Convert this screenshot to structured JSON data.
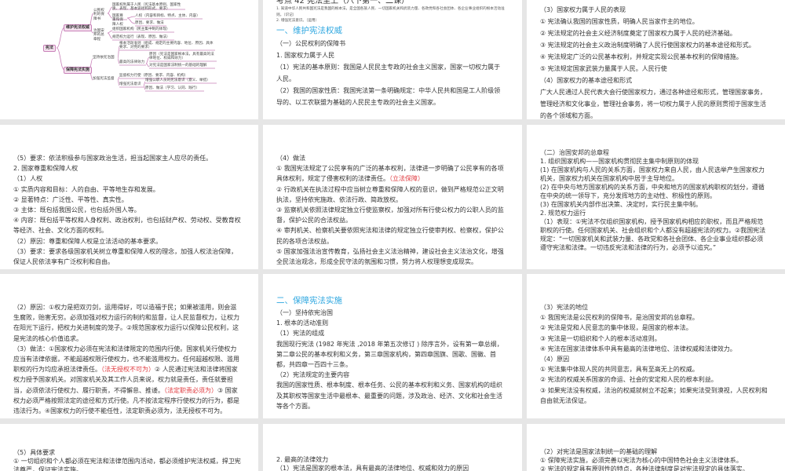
{
  "mindmap": {
    "root": "宪法",
    "b1": "维护宪法权威",
    "b2": "保障宪法实施",
    "b1_1": "公民权利的保障书",
    "b1_2": "治国安邦的总章程",
    "b2_1": "坚持依宪治国",
    "b2_2": "加强宪法监督",
    "n1": "国家权利属于人民（宪法基本原则、国家性质、表现、基本途径和形式、要求）",
    "n2": "国家尊重和保障人权",
    "n3": "人权（内容和目标、特点、主体、内容）",
    "n4": "原因、要求、做法",
    "n5": "组织国家机构（民主集中制的体现）",
    "n6": "规范权力运行（表现、原因、做法）",
    "n7": "根本活动准则（组成、规定的主要内容、地位、原因、具体要求、对党的要求）",
    "n8": "最高的法律效力",
    "n9": "原因（宪法是国家根本法，具有最高的法律地位、权威和效力）",
    "n10": "对宪法是国家法制统一的基础的理解",
    "n11": "监督权力行使（原因、要求、内容、机构）",
    "n12": "增强宪法意识",
    "n13": "增强公职人员的宪法意识（意义、举措）",
    "n14": "原因、做法（学习、认同、践行）"
  },
  "colors": {
    "heading": "#2ea7e0",
    "emphasis": "#e0393e",
    "mindmap_line": "#c880b8"
  },
  "slides": [
    {
      "id": "s2",
      "paras": [
        {
          "cls": "title",
          "t": "考点 42 宪法至上（八下第一、二课）"
        },
        {
          "cls": "small",
          "t": "1. 知道中华人民共和国宪法是我国的根本法，是全国各族人民、一切国家机关和武装力量、各政党和各社会团体、各企业事业组织的根本活动准则。（识记）"
        },
        {
          "cls": "small",
          "t": "2. 增强宪法意识。（运用）"
        },
        {
          "cls": "h-blue",
          "t": "一、维护宪法权威"
        },
        {
          "t": "（一）公民权利的保障书"
        },
        {
          "t": "1. 国家权力属于人民"
        },
        {
          "t": "（1）宪法的基本原则：我国是人民民主专政的社会主义国家，国家一切权力属于人民。"
        },
        {
          "t": "（2）我国的国家性质：我国宪法第一条明确规定：中华人民共和国是工人阶级领导的、以工农联盟为基础的人民民主专政的社会主义国家。"
        }
      ]
    },
    {
      "id": "s3",
      "paras": [
        {
          "t": "（3）国家权力属于人民的表现"
        },
        {
          "t": "① 宪法确认我国的国家性质，明确人民当家作主的地位。"
        },
        {
          "t": "② 宪法规定的社会主义经济制度奠定了国家权力属于人民的经济基础。"
        },
        {
          "t": "③ 宪法规定的社会主义政治制度明确了人民行使国家权力的基本途径和形式。"
        },
        {
          "t": "④ 宪法规定广泛的公民基本权利，并规定实现公民基本权利的保障措施。"
        },
        {
          "t": "⑤ 宪法规定国家武装力量属于人民。人民行使"
        },
        {
          "t": "（4）国家权力的基本途径和形式"
        },
        {
          "t": "广大人民通过人民代表大会行使国家权力，通过各种途径和形式，管理国家事务，管理经济和文化事业，管理社会事务，将一切权力属于人民的原则贯彻于国家生活的各个领域和方面。"
        }
      ]
    },
    {
      "id": "s4",
      "paras": [
        {
          "t": "（5）要求：依法积极参与国家政治生活，担当起国家主人应尽的责任。"
        },
        {
          "t": "2. 国家尊重和保障人权"
        },
        {
          "t": "（1）人权"
        },
        {
          "t": "① 实质内容和目标：人的自由、平等地生存和发展。"
        },
        {
          "t": "② 显著特点：广泛性、平等性、真实性。"
        },
        {
          "t": "③ 主体：既包括我国公民，也包括外国人等。"
        },
        {
          "t": "④ 内容：既包括平等权和人身权利、政治权利，也包括财产权、劳动权、受教育权等经济、社会、文化方面的权利。"
        },
        {
          "t": "（2）原因：尊重和保障人权是立法活动的基本要求。"
        },
        {
          "t": "（3）要求：要求各级国家机关树立尊重和保障人权的理念，加强人权法治保障，保证人民依法享有广泛权利和自由。"
        }
      ]
    },
    {
      "id": "s5",
      "paras": [
        {
          "t": "（4）做法"
        },
        {
          "t": "① 我国宪法规定了公民享有的广泛的基本权利，法律进一步明确了公民享有的各项具体权利，规定了侵害权利的法律责任。",
          "red": "（立法保障）"
        },
        {
          "t": "② 行政机关在执法过程中应当树立尊重和保障人权的意识，做到严格规范公正文明执法，坚持依宪施政、依法行政、简政放权。"
        },
        {
          "t": "③ 监察机关依照法律规定独立行使监察权，加强对所有行使公权力的公职人员的监督，保护公民的合法权益。"
        },
        {
          "t": "④ 审判机关、检察机关要依照宪法和法律的规定独立行使审判权、检察权，保护公民的各项合法权益。"
        },
        {
          "t": "⑤ 国家加强法治宣传教育，弘扬社会主义法治精神，建设社会主义法治文化，增强全民法治观念，形成全民守法的氛围和习惯，努力将人权理想变成现实。"
        }
      ]
    },
    {
      "id": "s6",
      "paras": [
        {
          "t": "（二）治国安邦的总章程"
        },
        {
          "t": "1. 组织国家机构——国家机构贯彻民主集中制原则的体现"
        },
        {
          "t": "(1) 在国家机构与人民的关系方面，国家权力来自人民，由人民选举产生国家权力机关，国家权力机关在国家机构中居于主导地位。"
        },
        {
          "t": "(2) 在中央与地方国家机构的关系方面，中央和地方的国家机构职权的划分，遵循在中央的统一领导下，充分发挥地方的主动性、积极性的原则。"
        },
        {
          "t": "(3) 在国家机关内部作出决策、决定时，实行民主集中制。"
        },
        {
          "t": "2. 规范权力运行"
        },
        {
          "t": "（1）表现：①宪法不仅组织国家机构，授予国家机构相应的职权，而且严格规范职权的行使。任何国家机关、社会组织和个人都没有超越宪法的权力。②我国宪法规定：“一切国家机关和武装力量、各政党和各社会团体、各企业事业组织都必须遵守宪法和法律。一切违反宪法和法律的行为，必须予以追究。”"
        }
      ]
    },
    {
      "id": "s7",
      "paras": [
        {
          "t": "（2）原因：①权力是把双刃剑，运用得好，可以造福于民；如果被滥用，则会滋生腐败，贻害无穷。必须加强对权力运行的制约和监督，让人民监督权力，让权力在阳光下运行，把权力关进制度的笼子。②规范国家权力运行以保障公民权利，这是宪法的核心价值追求。"
        },
        {
          "t": "（3）做法：①国家权力必须在宪法和法律限定的范围内行使。国家机关行使权力应当有法律依据，不能超越权限行使权力，也不能滥用权力。任何超越权限、滥用职权的行为均应承担法律责任。",
          "red": "（法无授权不可为）",
          "after": "② 人民通过宪法和法律将国家权力授予国家机关。对国家机关及其工作人员来说，权力就是责任，责任就要担当，必须依法行使权力、履行职责，不得懈怠、推诿。",
          "red2": "（法定职责必须为）",
          "after2": "③ 国家权力必须严格按照法定的途径和方式行使。凡不按法定程序行使权力的行为，都是违法行为。④国家权力的行使不能任性，法定职责必须为，法无授权不可为。"
        }
      ]
    },
    {
      "id": "s8",
      "paras": [
        {
          "cls": "h-blue",
          "t": "二、保障宪法实施"
        },
        {
          "t": "（一）坚持依宪治国"
        },
        {
          "t": "1. 根本的活动准则"
        },
        {
          "t": "（1）宪法的组成"
        },
        {
          "t": "我国现行宪法 (1982 年宪法 ,2018 年第五次修订 ) 除序言外，设有第一章总纲，第二章公民的基本权利和义务，第三章国家机构，第四章国旗、国歌、国徽、首都，共四章一百四十三条。"
        },
        {
          "t": "（2）宪法规定的主要内容"
        },
        {
          "t": "我国的国家性质、根本制度、根本任务、公民的基本权利和义务、国家机构的组织及其职权等国家生活中最根本、最重要的问题，涉及政治、经济、文化和社会生活等各个方面。"
        }
      ]
    },
    {
      "id": "s9",
      "paras": [
        {
          "t": "（3）宪法的地位"
        },
        {
          "t": "① 我国宪法是公民权利的保障书，是治国安邦的总章程。"
        },
        {
          "t": "② 宪法是党和人民意志的集中体现，是国家的根本法。"
        },
        {
          "t": "③ 宪法是一切组织和个人的根本活动准则。"
        },
        {
          "t": "④ 宪法在国家法律体系中具有最高的法律地位、法律权威和法律效力。"
        },
        {
          "t": "（4）原因"
        },
        {
          "t": "① 宪法集中体现人民的共同意志，具有至高无上的权威。"
        },
        {
          "t": "② 宪法的权威关系国家的命运、社会的安定和人民的根本利益。"
        },
        {
          "t": "③ 如果宪法没有权威，法治的权威就树立不起来；如果宪法受到漠视，人民权利和自由就无法保证。"
        }
      ]
    },
    {
      "id": "s10",
      "paras": [
        {
          "t": "（5）具体要求"
        },
        {
          "t": "① 一切组织和个人都必须在宪法和法律范围内活动，都必须维护宪法权威，捍卫宪法尊严，保证宪法实施。"
        }
      ]
    },
    {
      "id": "s11",
      "paras": [
        {
          "t": "2. 最高的法律效力"
        },
        {
          "t": "（1）宪法是国家的根本法，具有最高的法律地位、权威和效力的原因"
        }
      ]
    },
    {
      "id": "s12",
      "paras": [
        {
          "t": "（2）对宪法是国家法制统一的基础的理解"
        },
        {
          "t": "① 保障宪法实施，必须完善以宪法为核心的中国特色社会主义法律体系。"
        },
        {
          "t": "② 宪法的规定具有原则性的特点，各种法律制度是对宪法规定的具体落实。"
        }
      ]
    }
  ]
}
